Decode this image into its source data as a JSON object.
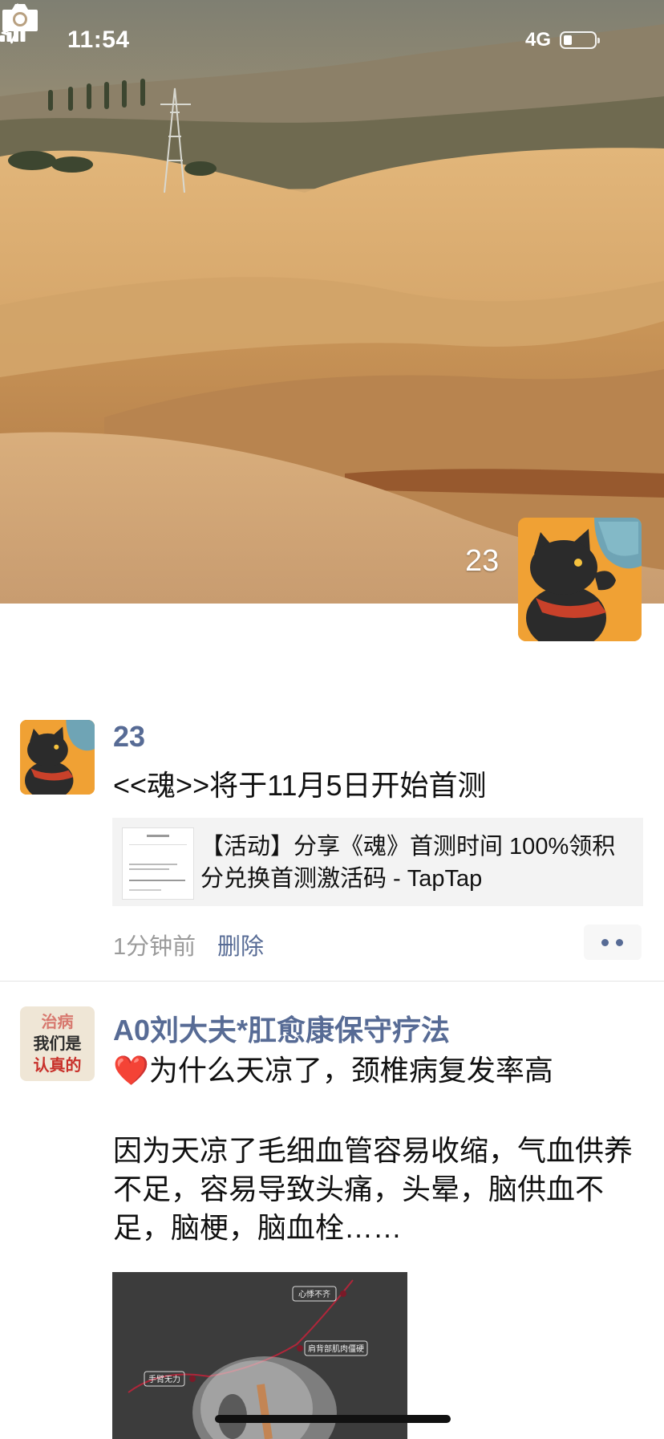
{
  "status_bar": {
    "time": "11:54",
    "network": "4G"
  },
  "cover": {
    "username": "23"
  },
  "posts": [
    {
      "name": "23",
      "text": "<<魂>>将于11月5日开始首测",
      "link": {
        "title": "【活动】分享《魂》首测时间 100%领积分兑换首测激活码 - TapTap"
      },
      "time": "1分钟前",
      "delete_label": "删除"
    },
    {
      "name": "A0刘大夫*肛愈康保守疗法",
      "avatar_text": [
        "治病",
        "我们是",
        "认真的"
      ],
      "heart_emoji": "❤️",
      "line1": "为什么天凉了，颈椎病复发率高",
      "line2": "因为天凉了毛细血管容易收缩，气血供养不足，容易导致头痛，头晕，脑供血不足，脑梗，脑血栓……",
      "image_labels": [
        "心悸不齐",
        "肩背部肌肉僵硬",
        "手臂无力"
      ]
    }
  ]
}
